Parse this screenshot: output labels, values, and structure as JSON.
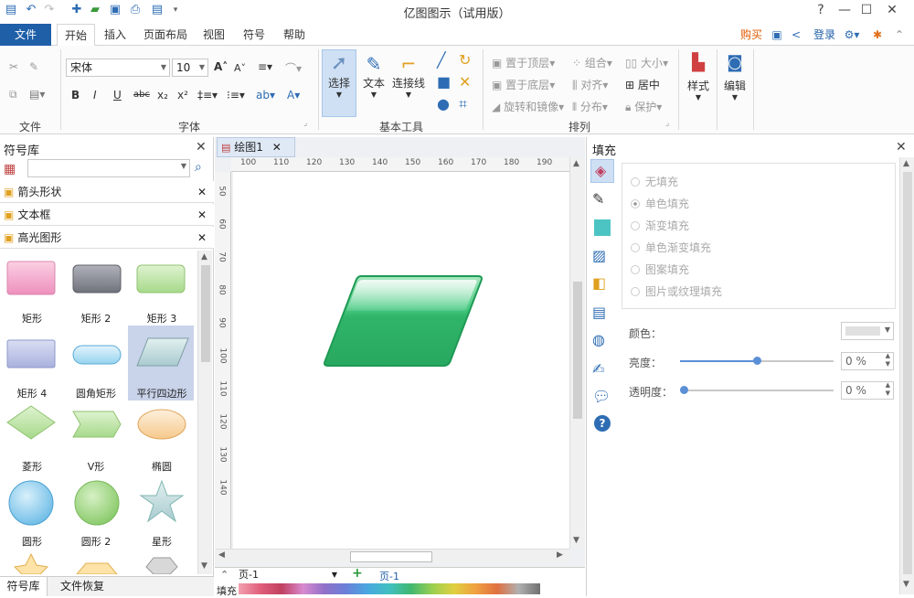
{
  "titlebar": {
    "title": "亿图图示（试用版）"
  },
  "menu_tabs": [
    "文件",
    "开始",
    "插入",
    "页面布局",
    "视图",
    "符号",
    "帮助"
  ],
  "menu_right": {
    "buy": "购买",
    "login": "登录"
  },
  "ribbon": {
    "font_name": "宋体",
    "font_size": "10",
    "groups": {
      "file": "文件",
      "font": "字体",
      "basic_tools": "基本工具",
      "arrange": "排列"
    },
    "tools": {
      "select": "选择",
      "text": "文本",
      "connector": "连接线",
      "style": "样式",
      "edit": "编辑"
    },
    "arrange_items": {
      "bring_front": "置于顶层",
      "send_back": "置于底层",
      "rotate": "旋转和镜像",
      "group": "组合",
      "align": "对齐",
      "distribute": "分布",
      "size": "大小",
      "center": "居中",
      "protect": "保护"
    },
    "format_buttons": [
      "B",
      "I",
      "U",
      "abc",
      "x₂",
      "x²"
    ]
  },
  "left_panel": {
    "title": "符号库",
    "search_placeholder": "",
    "categories": [
      "箭头形状",
      "文本框",
      "高光图形"
    ],
    "shapes": [
      {
        "label": "矩形"
      },
      {
        "label": "矩形 2"
      },
      {
        "label": "矩形 3"
      },
      {
        "label": "矩形 4"
      },
      {
        "label": "圆角矩形"
      },
      {
        "label": "平行四边形"
      },
      {
        "label": "菱形"
      },
      {
        "label": "V形"
      },
      {
        "label": "椭圆"
      },
      {
        "label": "圆形"
      },
      {
        "label": "圆形 2"
      },
      {
        "label": "星形"
      }
    ],
    "bottom_tabs": [
      "符号库",
      "文件恢复"
    ]
  },
  "document": {
    "tab_name": "绘图1",
    "ruler_h": [
      "100",
      "110",
      "120",
      "130",
      "140",
      "150",
      "160",
      "170",
      "180",
      "190"
    ],
    "ruler_v": [
      "50",
      "60",
      "70",
      "80",
      "90",
      "100",
      "110",
      "120",
      "130",
      "140"
    ],
    "page_select": "页-1",
    "page_tab": "页-1",
    "fill_label": "填充"
  },
  "right_panel": {
    "title": "填充",
    "fill_options": [
      "无填充",
      "单色填充",
      "渐变填充",
      "单色渐变填充",
      "图案填充",
      "图片或纹理填充"
    ],
    "selected_option": "单色填充",
    "color_label": "颜色：",
    "brightness_label": "亮度：",
    "brightness_value": "0 %",
    "brightness_level": 0.5,
    "transparency_label": "透明度：",
    "transparency_value": "0 %",
    "transparency_level": 0
  },
  "colors": {
    "accent": "#1f5fa8",
    "shape_green": "#2fb56a",
    "selection": "#cfe0f4",
    "buy_red": "#e05a00"
  }
}
